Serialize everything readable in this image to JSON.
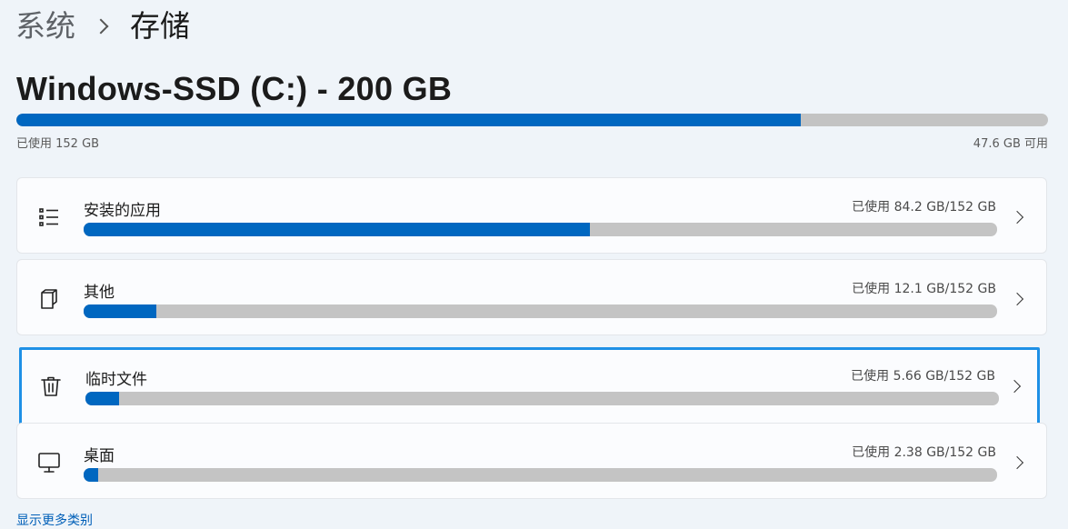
{
  "breadcrumb": {
    "parent": "系统",
    "current": "存储"
  },
  "drive": {
    "title": "Windows-SSD (C:) - 200 GB",
    "used_label": "已使用 152 GB",
    "free_label": "47.6 GB 可用",
    "used_fraction": 0.76
  },
  "categories": [
    {
      "label": "安装的应用",
      "usage": "已使用 84.2 GB/152 GB",
      "fraction": 0.554,
      "icon": "app-list-icon"
    },
    {
      "label": "其他",
      "usage": "已使用 12.1 GB/152 GB",
      "fraction": 0.08,
      "icon": "other-files-icon"
    },
    {
      "label": "临时文件",
      "usage": "已使用 5.66 GB/152 GB",
      "fraction": 0.037,
      "icon": "trash-icon"
    },
    {
      "label": "桌面",
      "usage": "已使用 2.38 GB/152 GB",
      "fraction": 0.016,
      "icon": "monitor-icon"
    }
  ],
  "more_link": "显示更多类别",
  "colors": {
    "accent": "#0067c0",
    "track": "#c4c4c4",
    "focus": "#1e90e6"
  }
}
